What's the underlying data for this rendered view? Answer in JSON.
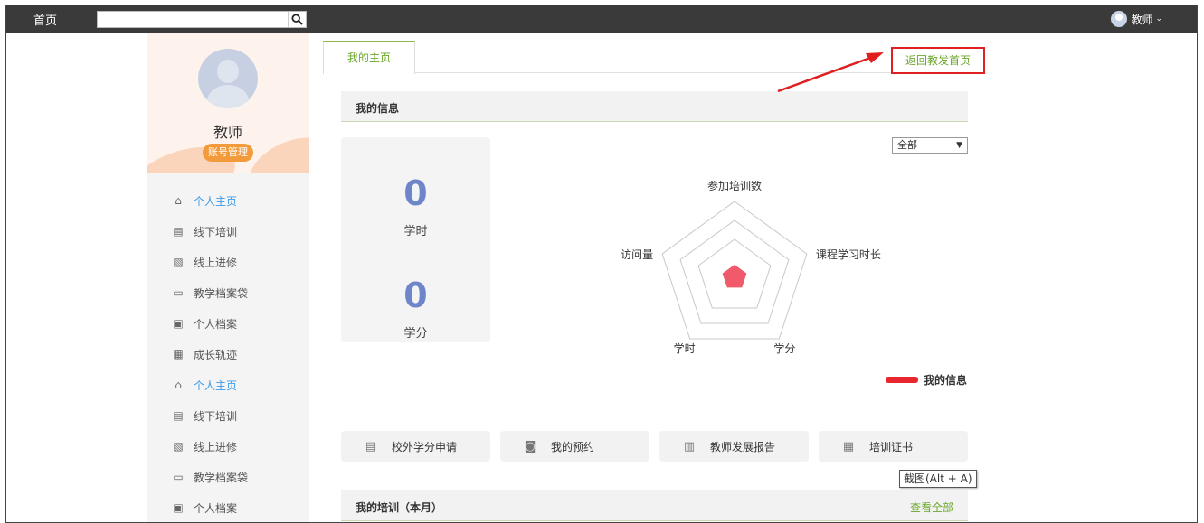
{
  "topbar": {
    "home_label": "首页",
    "search": {
      "value": "",
      "placeholder": ""
    },
    "user_name": "教师"
  },
  "sidebar": {
    "profile_name": "教师",
    "account_button": "账号管理",
    "items": [
      {
        "label": "个人主页",
        "icon": "home-icon",
        "active": true
      },
      {
        "label": "线下培训",
        "icon": "offline-training-icon",
        "active": false
      },
      {
        "label": "线上进修",
        "icon": "online-study-icon",
        "active": false
      },
      {
        "label": "教学档案袋",
        "icon": "folder-icon",
        "active": false
      },
      {
        "label": "个人档案",
        "icon": "profile-file-icon",
        "active": false
      },
      {
        "label": "成长轨迹",
        "icon": "growth-track-icon",
        "active": false
      },
      {
        "label": "个人主页",
        "icon": "home-icon",
        "active": true
      },
      {
        "label": "线下培训",
        "icon": "offline-training-icon",
        "active": false
      },
      {
        "label": "线上进修",
        "icon": "online-study-icon",
        "active": false
      },
      {
        "label": "教学档案袋",
        "icon": "folder-icon",
        "active": false
      },
      {
        "label": "个人档案",
        "icon": "profile-file-icon",
        "active": false
      }
    ]
  },
  "main": {
    "tab_label": "我的主页",
    "return_link": "返回教发首页",
    "info_section": {
      "title": "我的信息",
      "hours_value": "0",
      "hours_label": "学时",
      "credits_value": "0",
      "credits_label": "学分",
      "filter_selected": "全部",
      "legend_label": "我的信息",
      "legend_color": "#e8262e"
    },
    "actions": [
      {
        "label": "校外学分申请",
        "icon": "credit-apply-icon"
      },
      {
        "label": "我的预约",
        "icon": "appointment-icon"
      },
      {
        "label": "教师发展报告",
        "icon": "report-icon"
      },
      {
        "label": "培训证书",
        "icon": "certificate-icon"
      }
    ],
    "training_section": {
      "title": "我的培训（本月）",
      "view_all": "查看全部"
    },
    "tooltip": "截图(Alt + A)"
  },
  "chart_data": {
    "type": "radar",
    "axes": [
      "参加培训数",
      "课程学习时长",
      "学分",
      "学时",
      "访问量"
    ],
    "series": [
      {
        "name": "我的信息",
        "values": [
          0,
          0,
          0,
          0,
          0
        ],
        "color": "#f05a6a"
      }
    ]
  },
  "colors": {
    "accent_green": "#6aa62a",
    "active_blue": "#3c9be8",
    "highlight_red": "#e02020",
    "orange": "#f39b3a"
  }
}
